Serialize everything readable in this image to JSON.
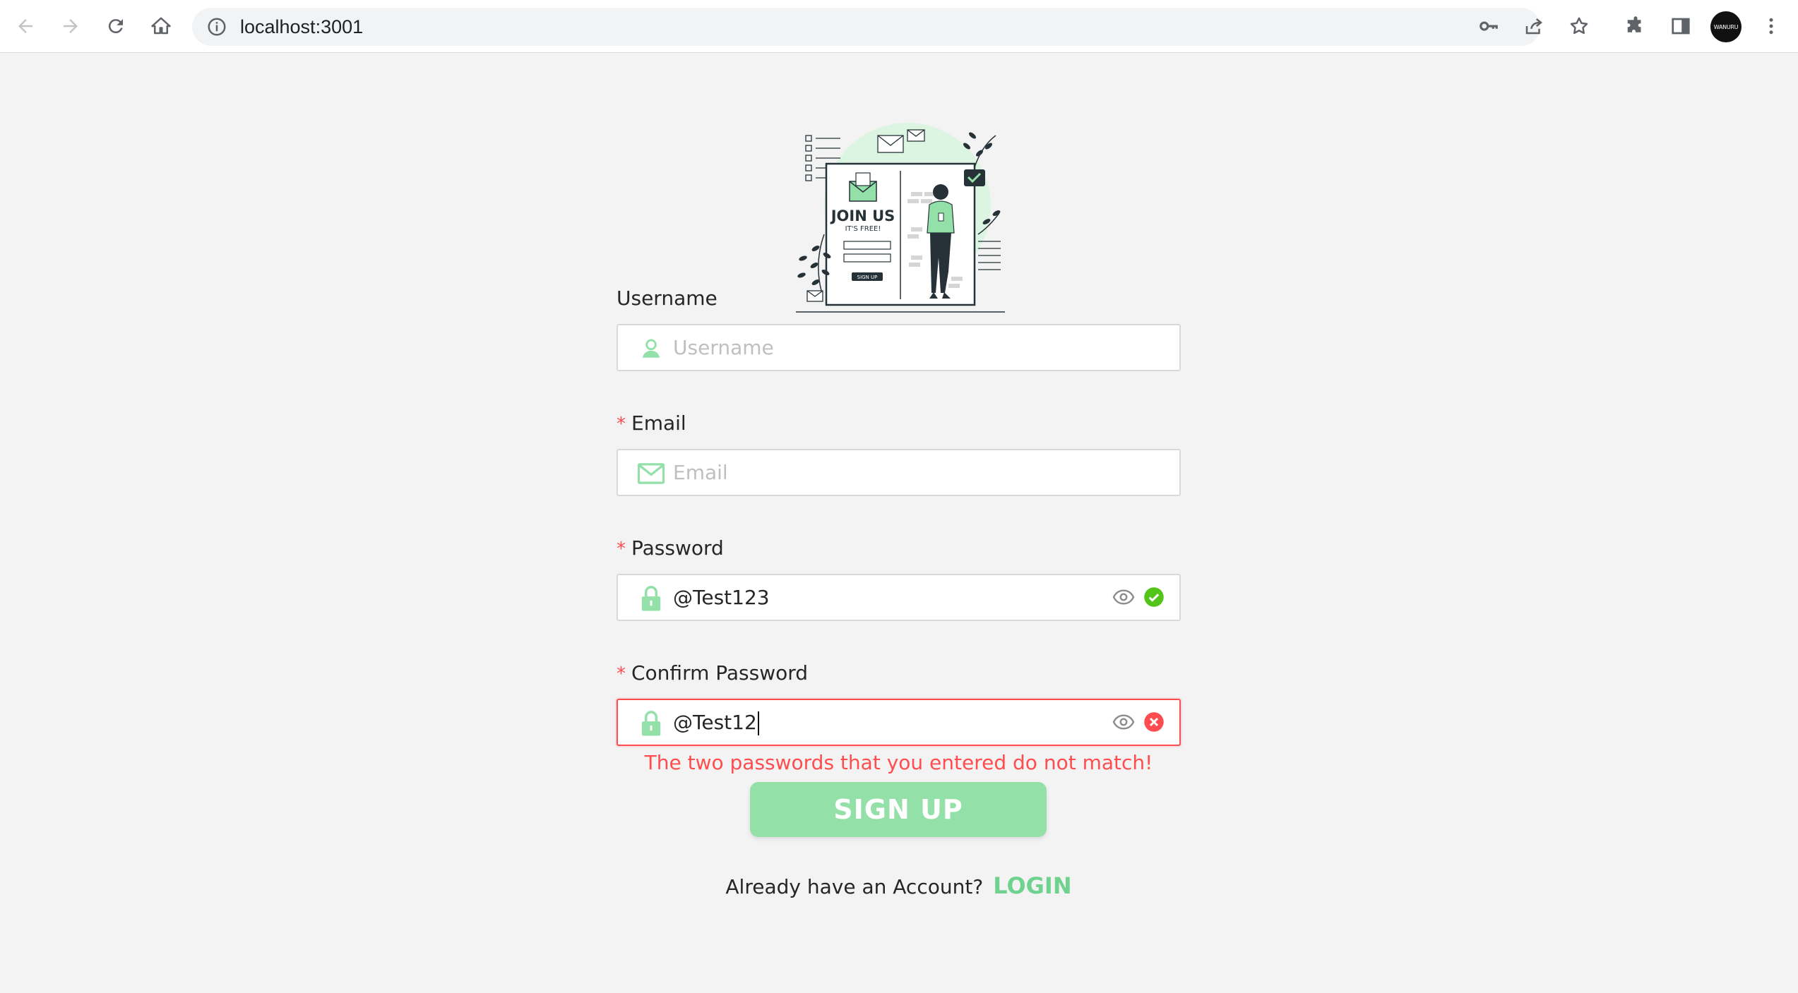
{
  "browser": {
    "url": "localhost:3001",
    "profile_label": "WANURU"
  },
  "illustration": {
    "heading": "JOIN US",
    "subheading": "IT'S FREE!",
    "button": "SIGN UP"
  },
  "form": {
    "username": {
      "label": "Username",
      "placeholder": "Username"
    },
    "email": {
      "required_mark": "*",
      "label": "Email",
      "placeholder": "Email"
    },
    "password": {
      "required_mark": "*",
      "label": "Password",
      "value": "@Test123"
    },
    "confirm_password": {
      "required_mark": "*",
      "label": "Confirm Password",
      "value": "@Test12",
      "error": "The two passwords that you entered do not match!"
    },
    "submit_label": "SIGN UP",
    "account_prompt": "Already have an Account?",
    "login_label": "LOGIN"
  },
  "colors": {
    "accent": "#93e0a8",
    "accent_dark": "#6fd38f",
    "error": "#ff4d4f",
    "success": "#52c41a"
  }
}
